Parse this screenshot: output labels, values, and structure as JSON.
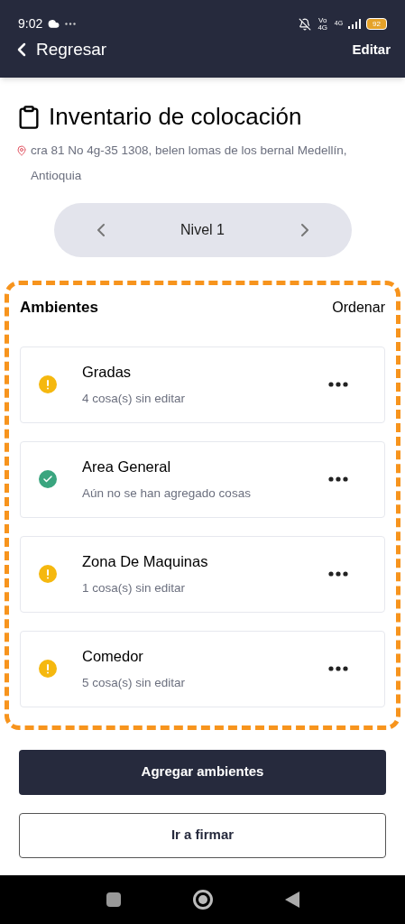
{
  "status_bar": {
    "time": "9:02",
    "network": "Vo 4G",
    "data": "4G",
    "battery": "92"
  },
  "header": {
    "back_label": "Regresar",
    "action": "Editar"
  },
  "title": "Inventario de colocación",
  "address": "cra 81 No 4g-35 1308, belen lomas de los bernal Medellín, Antioquia",
  "level_selector": {
    "label": "Nivel 1"
  },
  "section": {
    "title": "Ambientes",
    "action": "Ordenar",
    "highlighted": true
  },
  "rooms": [
    {
      "name": "Gradas",
      "subtitle": "4 cosa(s) sin editar",
      "kind": "warning"
    },
    {
      "name": "Area General",
      "subtitle": "Aún no se han agregado cosas",
      "kind": "done"
    },
    {
      "name": "Zona De Maquinas",
      "subtitle": "1 cosa(s) sin editar",
      "kind": "warning"
    },
    {
      "name": "Comedor",
      "subtitle": "5 cosa(s) sin editar",
      "kind": "warning"
    }
  ],
  "buttons": [
    {
      "label": "Agregar ambientes",
      "kind": "primary"
    },
    {
      "label": "Ir a firmar",
      "kind": "outline"
    }
  ]
}
